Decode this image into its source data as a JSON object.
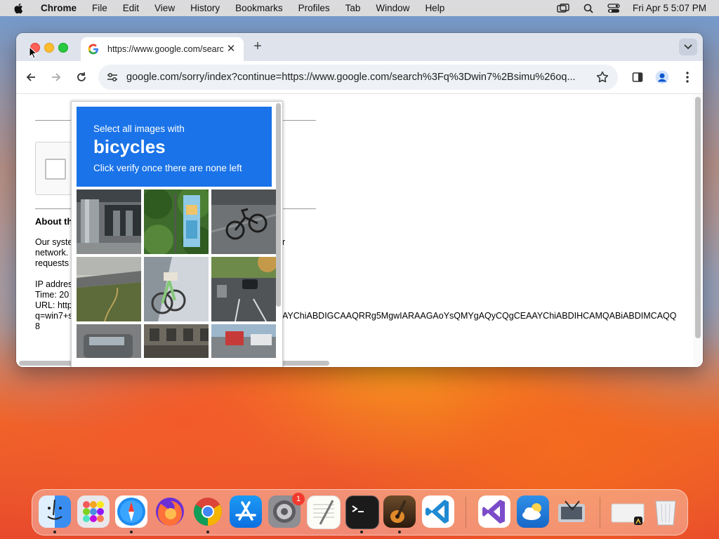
{
  "menubar": {
    "app": "Chrome",
    "items": [
      "File",
      "Edit",
      "View",
      "History",
      "Bookmarks",
      "Profiles",
      "Tab",
      "Window",
      "Help"
    ],
    "datetime": "Fri Apr 5  5:07 PM"
  },
  "browser": {
    "tab_title": "https://www.google.com/search",
    "url": "google.com/sorry/index?continue=https://www.google.com/search%3Fq%3Dwin7%2Bsimu%26oq..."
  },
  "page": {
    "about_heading": "About th",
    "lines": [
      "Our syste",
      "network.",
      "requests"
    ],
    "line_tail": "r",
    "ip_label": "IP addres",
    "time_label": "Time: 20",
    "url_label": "URL: http",
    "url_cont": "q=win7+s",
    "url_long": "AYChiABDIGCAAQRRg5MgwIARAAGAoYsQMYgAQyCQgCEAAYChiABDIHCAMQABiABDIMCAQQ",
    "url_end": "8"
  },
  "captcha": {
    "line1": "Select all images with",
    "keyword": "bicycles",
    "line3": "Click verify once there are none left"
  },
  "dock": {
    "settings_badge": "1"
  }
}
